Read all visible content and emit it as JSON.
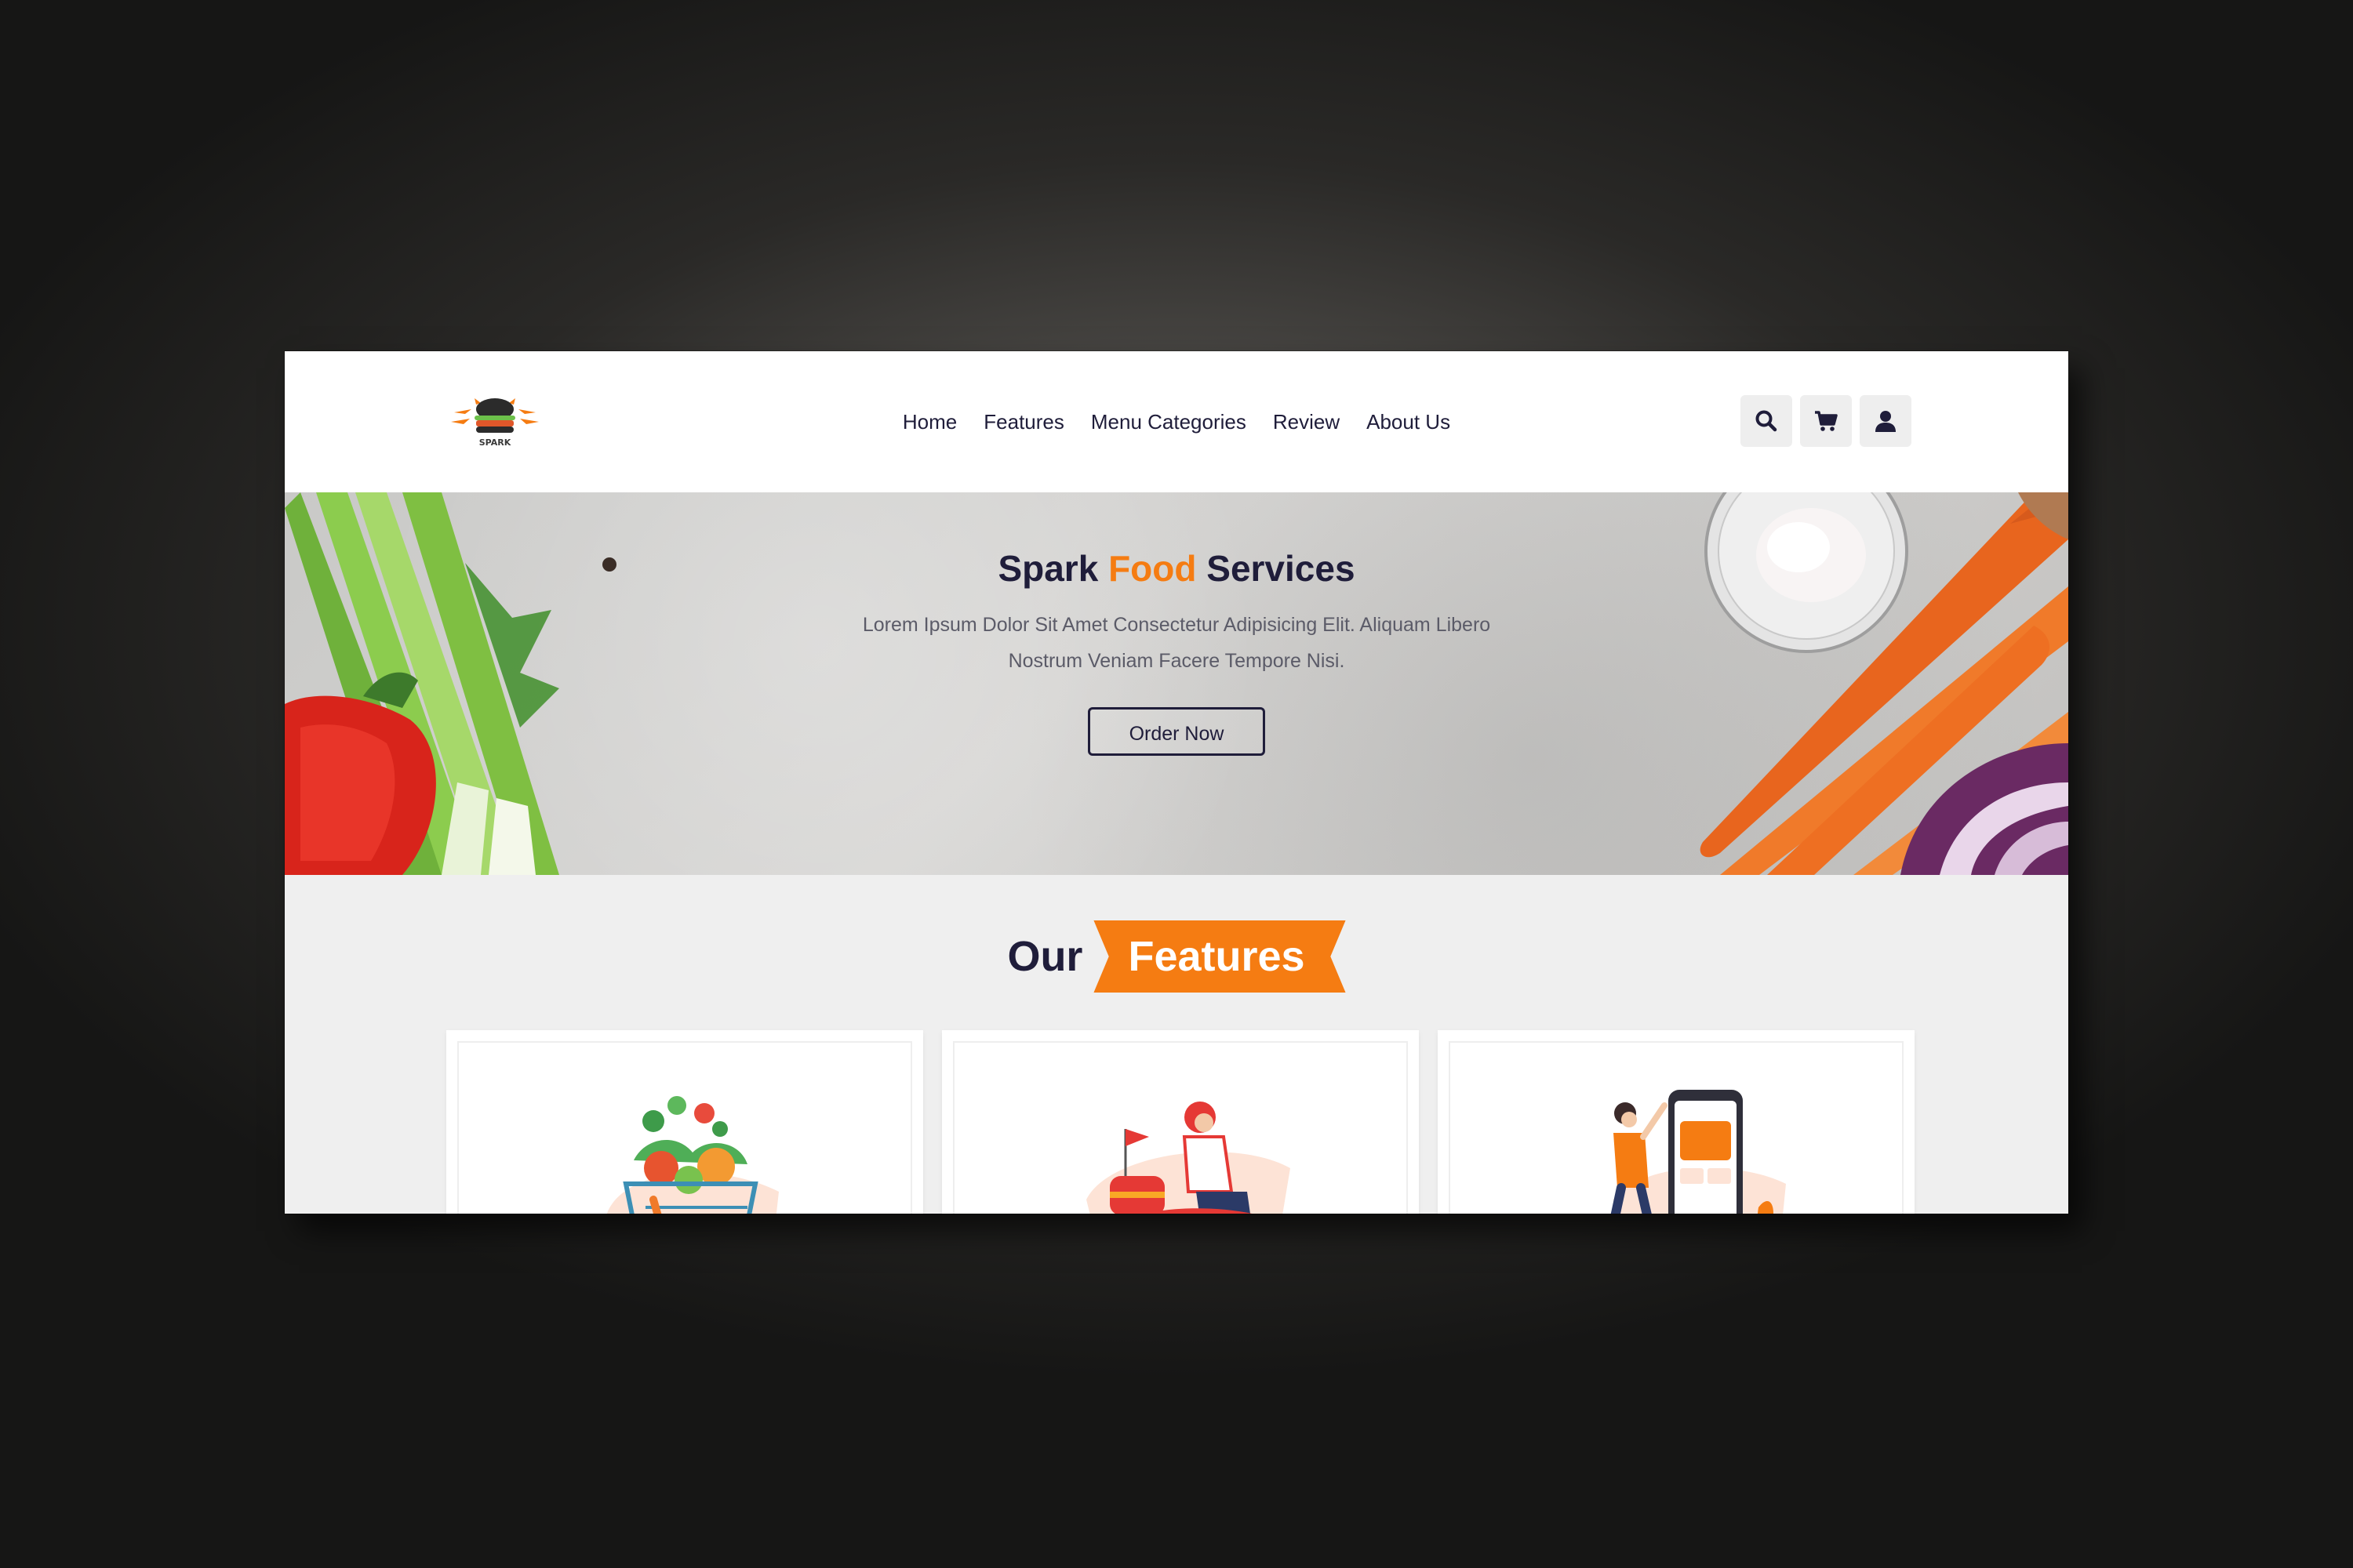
{
  "brand": {
    "logo_text": "SPARK"
  },
  "nav": {
    "items": [
      {
        "label": "Home"
      },
      {
        "label": "Features"
      },
      {
        "label": "Menu Categories"
      },
      {
        "label": "Review"
      },
      {
        "label": "About Us"
      }
    ]
  },
  "header_icons": [
    "search-icon",
    "cart-icon",
    "user-icon"
  ],
  "hero": {
    "title_part1": "Spark ",
    "title_accent": "Food",
    "title_part2": " Services",
    "subtitle": "Lorem Ipsum Dolor Sit Amet Consectetur Adipisicing Elit. Aliquam Libero Nostrum Veniam Facere Tempore Nisi.",
    "cta_label": "Order Now"
  },
  "features": {
    "title_part1": "Our",
    "title_accent": "Features",
    "cards": [
      {
        "illustration": "vegetable-basket-illustration"
      },
      {
        "illustration": "delivery-scooter-illustration"
      },
      {
        "illustration": "mobile-payment-illustration"
      }
    ]
  },
  "colors": {
    "accent": "#f57c12",
    "dark": "#1f1d3a",
    "text_muted": "#5b5b68",
    "section_bg": "#efefef"
  }
}
